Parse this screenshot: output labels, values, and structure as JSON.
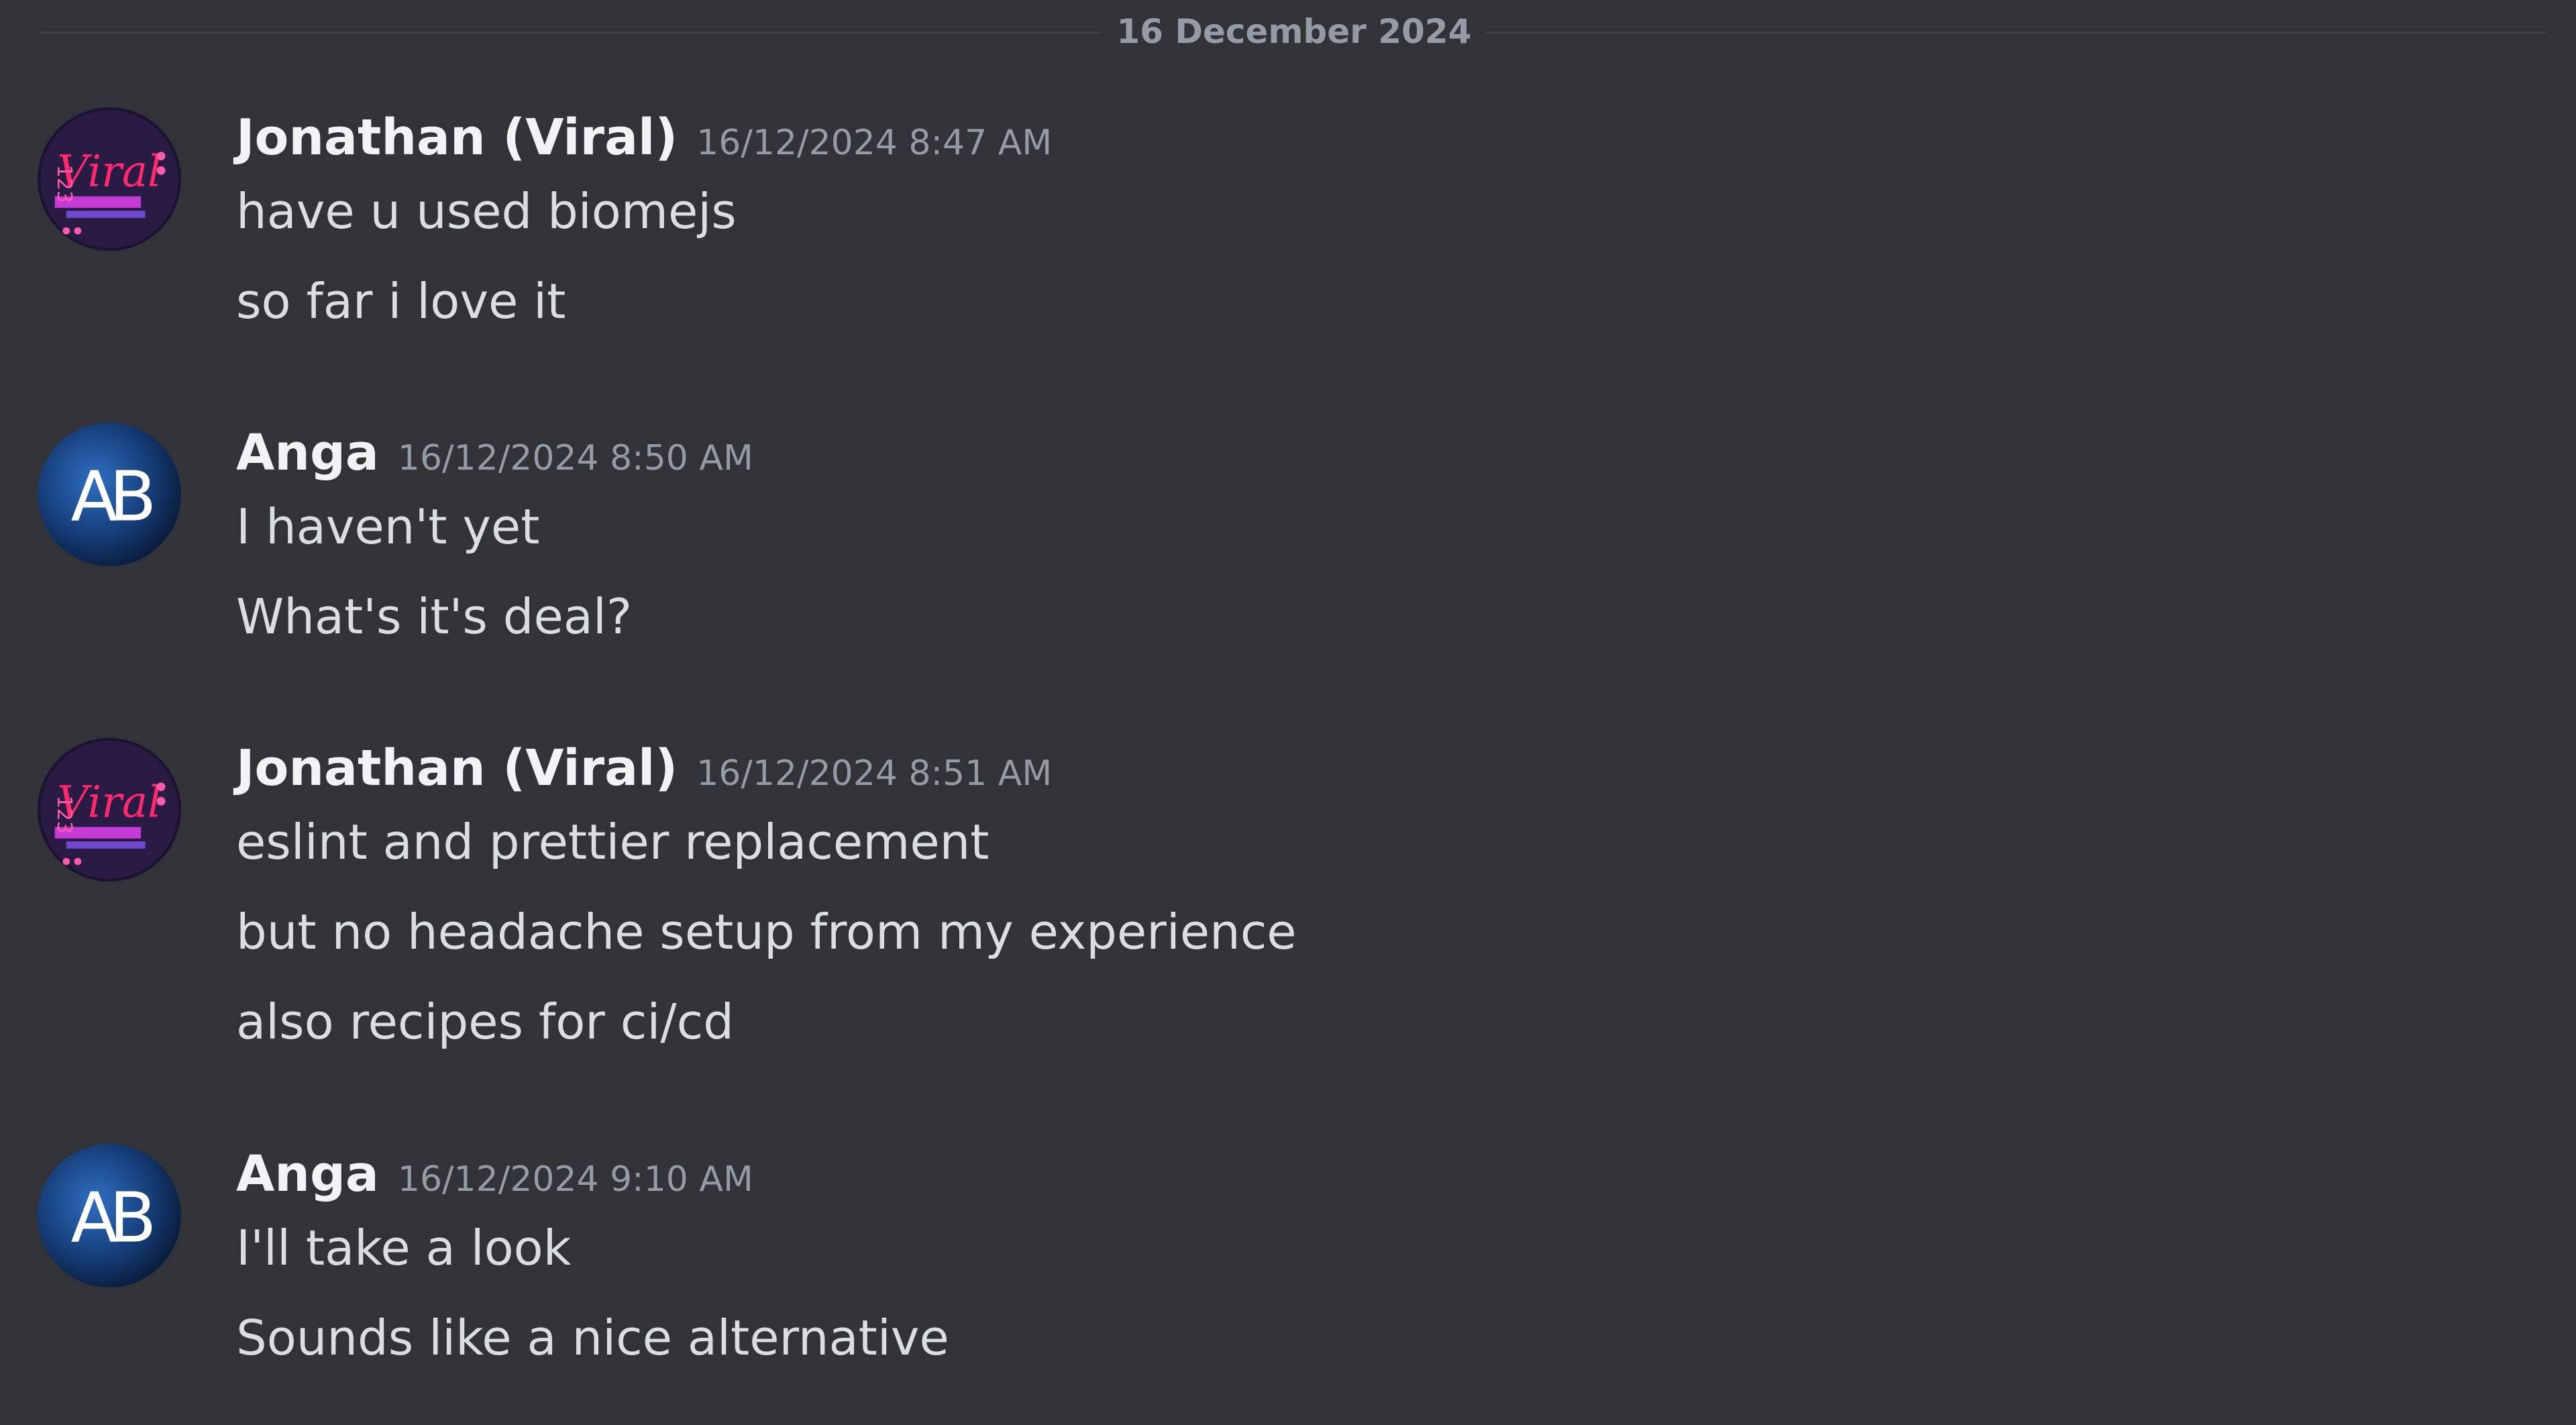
{
  "date_divider": "16 December 2024",
  "colors": {
    "background": "#313338",
    "username": "#f2f3f5",
    "message_text": "#dbdee1",
    "timestamp": "#949ba4",
    "divider_line": "#3f4147"
  },
  "messages": [
    {
      "author": "Jonathan (Viral)",
      "timestamp": "16/12/2024 8:47 AM",
      "avatar_icon": "viral-logo-avatar",
      "lines": [
        "have u used biomejs",
        "so far i love it"
      ]
    },
    {
      "author": "Anga",
      "timestamp": "16/12/2024 8:50 AM",
      "avatar_icon": "ab-monogram-avatar",
      "lines": [
        "I haven't yet",
        "What's it's deal?"
      ]
    },
    {
      "author": "Jonathan (Viral)",
      "timestamp": "16/12/2024 8:51 AM",
      "avatar_icon": "viral-logo-avatar",
      "lines": [
        "eslint and prettier replacement",
        "but no headache setup from my experience",
        "also recipes for ci/cd"
      ]
    },
    {
      "author": "Anga",
      "timestamp": "16/12/2024 9:10 AM",
      "avatar_icon": "ab-monogram-avatar",
      "lines": [
        "I'll take a look",
        "Sounds like a nice alternative"
      ]
    }
  ]
}
